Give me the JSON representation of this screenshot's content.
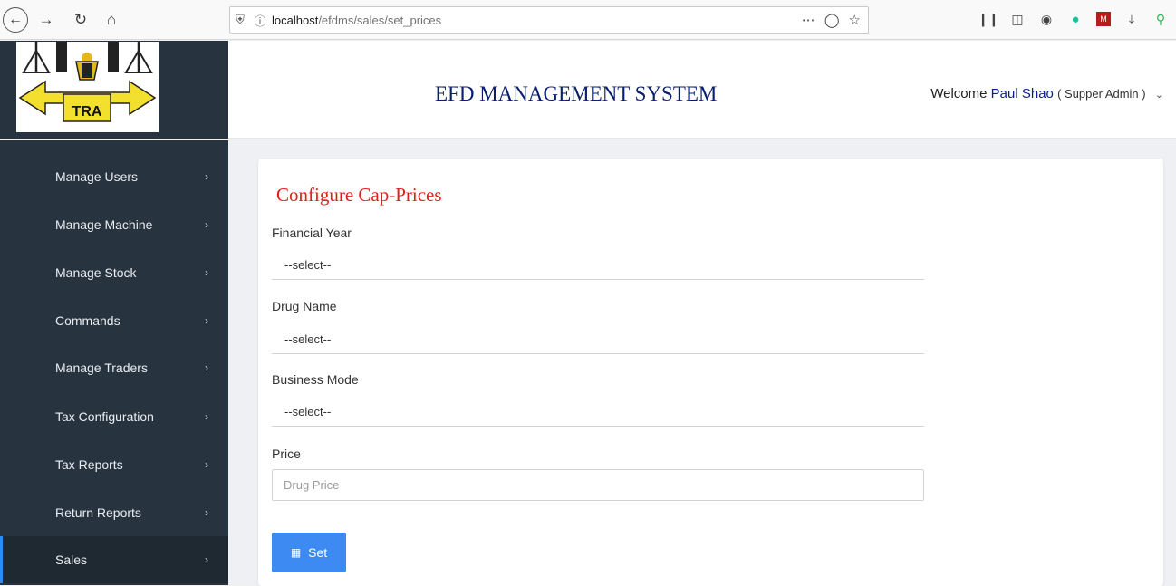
{
  "browser": {
    "url_prefix": "localhost",
    "url_path": "/efdms/sales/set_prices"
  },
  "header": {
    "logo_text": "TRA",
    "title": "EFD MANAGEMENT SYSTEM",
    "welcome_prefix": "Welcome",
    "user_name": "Paul Shao",
    "user_role": "( Supper Admin )"
  },
  "sidebar": {
    "items": [
      {
        "label": "Manage Users"
      },
      {
        "label": "Manage Machine"
      },
      {
        "label": "Manage Stock"
      },
      {
        "label": "Commands"
      },
      {
        "label": "Manage Traders"
      },
      {
        "label": "Tax Configuration"
      },
      {
        "label": "Tax Reports"
      },
      {
        "label": "Return Reports"
      },
      {
        "label": "Sales"
      }
    ],
    "active": "Sales"
  },
  "form": {
    "title": "Configure Cap-Prices",
    "financial_year_label": "Financial Year",
    "financial_year_value": "--select--",
    "drug_name_label": "Drug Name",
    "drug_name_value": "--select--",
    "business_mode_label": "Business Mode",
    "business_mode_value": "--select--",
    "price_label": "Price",
    "price_placeholder": "Drug Price",
    "set_label": "Set"
  }
}
